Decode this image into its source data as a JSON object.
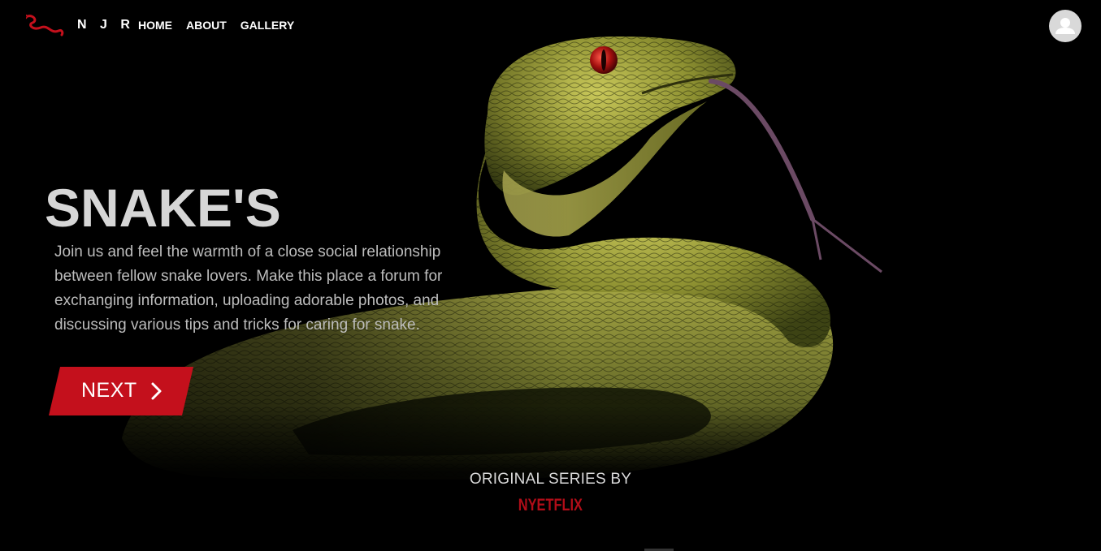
{
  "nav": {
    "brand": "N J R",
    "links": [
      "HOME",
      "ABOUT",
      "GALLERY"
    ],
    "logo_icon": "snake-logo-icon",
    "avatar_icon": "user-avatar-icon"
  },
  "hero": {
    "title": "SNAKE'S",
    "description": "Join us and feel the warmth of a close social relationship between fellow snake lovers. Make this place a forum for exchanging information, uploading adorable photos, and discussing various tips and tricks for caring for snake.",
    "button_label": "NEXT",
    "button_icon": "chevron-right-icon"
  },
  "footer": {
    "original_series": "ORIGINAL SERIES BY",
    "brand": "NYETFLIX"
  },
  "colors": {
    "accent": "#c4101c",
    "background": "#000000",
    "brand_logo": "#b00d18"
  }
}
